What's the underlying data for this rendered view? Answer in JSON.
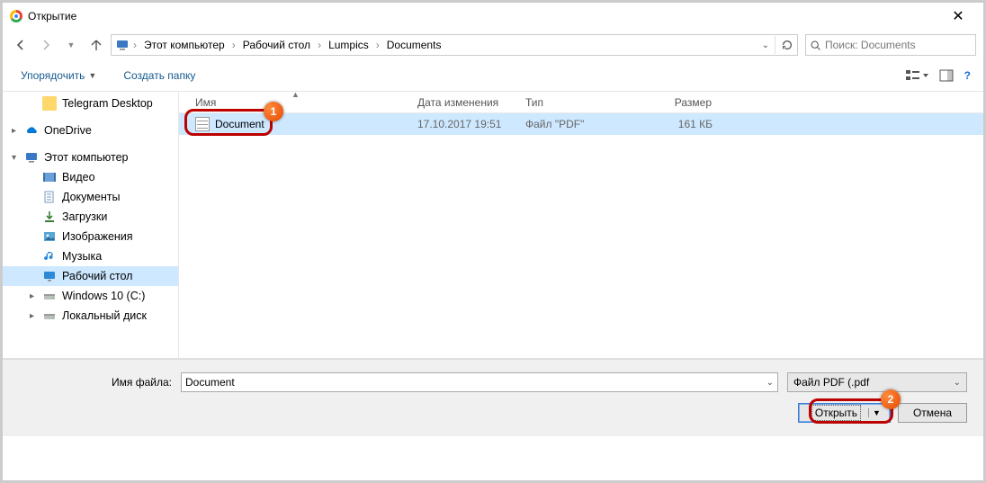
{
  "title": "Открытие",
  "nav": {
    "breadcrumbs": [
      "Этот компьютер",
      "Рабочий стол",
      "Lumpics",
      "Documents"
    ],
    "search_placeholder": "Поиск: Documents"
  },
  "toolbar": {
    "organize": "Упорядочить",
    "new_folder": "Создать папку"
  },
  "sidebar": {
    "items": [
      {
        "label": "Telegram Desktop",
        "icon": "folder",
        "indent": 2
      },
      {
        "label": "OneDrive",
        "icon": "onedrive",
        "indent": 1,
        "caret": ">"
      },
      {
        "label": "Этот компьютер",
        "icon": "pc",
        "indent": 1,
        "caret": "v"
      },
      {
        "label": "Видео",
        "icon": "video",
        "indent": 2
      },
      {
        "label": "Документы",
        "icon": "docs",
        "indent": 2
      },
      {
        "label": "Загрузки",
        "icon": "downloads",
        "indent": 2
      },
      {
        "label": "Изображения",
        "icon": "images",
        "indent": 2
      },
      {
        "label": "Музыка",
        "icon": "music",
        "indent": 2
      },
      {
        "label": "Рабочий стол",
        "icon": "desktop",
        "indent": 2,
        "selected": true
      },
      {
        "label": "Windows 10 (C:)",
        "icon": "drive",
        "indent": 2,
        "caret": ">"
      },
      {
        "label": "Локальный диск",
        "icon": "drive",
        "indent": 2,
        "caret": ">"
      }
    ]
  },
  "columns": {
    "name": "Имя",
    "date": "Дата изменения",
    "type": "Тип",
    "size": "Размер"
  },
  "files": [
    {
      "name": "Document",
      "date": "17.10.2017 19:51",
      "type": "Файл \"PDF\"",
      "size": "161 КБ"
    }
  ],
  "bottom": {
    "filename_label": "Имя файла:",
    "filename_value": "Document",
    "filter_label": "Файл PDF (.pdf",
    "open": "Открыть",
    "cancel": "Отмена"
  },
  "badges": {
    "b1": "1",
    "b2": "2"
  }
}
